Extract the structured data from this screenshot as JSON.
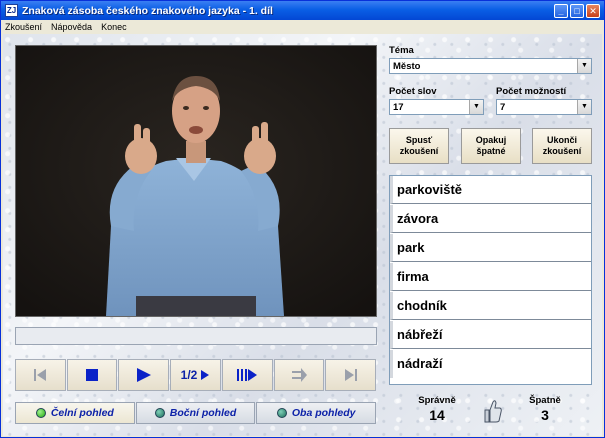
{
  "window": {
    "title": "Znaková zásoba českého znakového jazyka  - 1. díl",
    "icon_text": "ZJ",
    "minimize_glyph": "_",
    "maximize_glyph": "□",
    "close_glyph": "✕"
  },
  "menu": [
    "Zkoušení",
    "Nápověda",
    "Konec"
  ],
  "playback": {
    "half_label": "1/2"
  },
  "views": [
    {
      "label": "Čelní pohled",
      "active": true
    },
    {
      "label": "Boční pohled",
      "active": false
    },
    {
      "label": "Oba pohledy",
      "active": false
    }
  ],
  "settings": {
    "topic_label": "Téma",
    "topic_value": "Město",
    "word_count_label": "Počet slov",
    "word_count_value": "17",
    "options_label": "Počet možností",
    "options_value": "7"
  },
  "actions": {
    "start": "Spusť zkoušení",
    "repeat": "Opakuj špatné",
    "end": "Ukonči zkoušení"
  },
  "words": [
    "parkoviště",
    "závora",
    "park",
    "firma",
    "chodník",
    "nábřeží",
    "nádraží"
  ],
  "score": {
    "correct_label": "Správně",
    "correct_value": "14",
    "wrong_label": "Špatně",
    "wrong_value": "3"
  }
}
